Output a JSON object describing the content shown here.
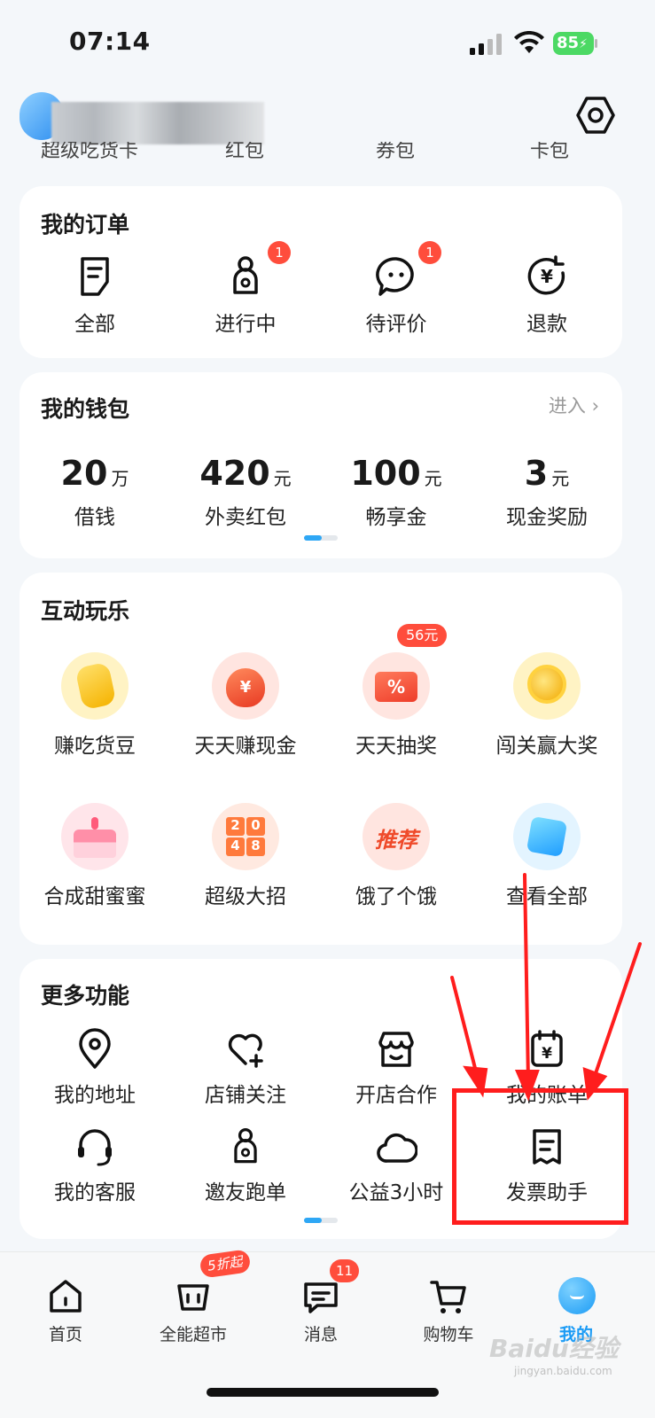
{
  "status_bar": {
    "time": "07:14",
    "battery": "85"
  },
  "header": {
    "peek_labels": [
      "超级吃货卡",
      "红包",
      "券包",
      "卡包"
    ]
  },
  "orders": {
    "title": "我的订单",
    "items": [
      {
        "label": "全部",
        "icon": "document-icon",
        "badge": ""
      },
      {
        "label": "进行中",
        "icon": "courier-icon",
        "badge": "1"
      },
      {
        "label": "待评价",
        "icon": "chat-bubble-icon",
        "badge": "1"
      },
      {
        "label": "退款",
        "icon": "refund-icon",
        "badge": ""
      }
    ]
  },
  "wallet": {
    "title": "我的钱包",
    "enter": "进入 ›",
    "items": [
      {
        "value": "20",
        "unit": "万",
        "label": "借钱"
      },
      {
        "value": "420",
        "unit": "元",
        "label": "外卖红包"
      },
      {
        "value": "100",
        "unit": "元",
        "label": "畅享金"
      },
      {
        "value": "3",
        "unit": "元",
        "label": "现金奖励"
      }
    ]
  },
  "games": {
    "title": "互动玩乐",
    "items": [
      {
        "label": "赚吃货豆",
        "icon": "bean-icon"
      },
      {
        "label": "天天赚现金",
        "icon": "money-bag-icon"
      },
      {
        "label": "天天抽奖",
        "icon": "lottery-ticket-icon",
        "badge": "56元"
      },
      {
        "label": "闯关赢大奖",
        "icon": "gold-coin-icon"
      },
      {
        "label": "合成甜蜜蜜",
        "icon": "cake-icon"
      },
      {
        "label": "超级大招",
        "icon": "game-2048-icon",
        "tile_text": [
          "2",
          "0",
          "4",
          "8"
        ]
      },
      {
        "label": "饿了个饿",
        "icon": "recommend-icon",
        "tile_text": "推荐"
      },
      {
        "label": "查看全部",
        "icon": "cube-icon"
      }
    ]
  },
  "more": {
    "title": "更多功能",
    "items": [
      {
        "label": "我的地址",
        "icon": "location-icon"
      },
      {
        "label": "店铺关注",
        "icon": "heart-plus-icon"
      },
      {
        "label": "开店合作",
        "icon": "shop-icon"
      },
      {
        "label": "我的账单",
        "icon": "bill-icon"
      },
      {
        "label": "我的客服",
        "icon": "headset-icon"
      },
      {
        "label": "邀友跑单",
        "icon": "courier-icon"
      },
      {
        "label": "公益3小时",
        "icon": "cloud-icon"
      },
      {
        "label": "发票助手",
        "icon": "invoice-icon"
      }
    ]
  },
  "tabbar": {
    "items": [
      {
        "label": "首页",
        "icon": "home-icon",
        "badge": ""
      },
      {
        "label": "全能超市",
        "icon": "supermarket-icon",
        "badge": "5折起"
      },
      {
        "label": "消息",
        "icon": "message-icon",
        "badge": "11"
      },
      {
        "label": "购物车",
        "icon": "cart-icon",
        "badge": ""
      },
      {
        "label": "我的",
        "icon": "profile-icon",
        "badge": ""
      }
    ]
  },
  "colors": {
    "accent": "#2ea7f5",
    "badge": "#ff4d3c",
    "annotation": "#ff1d1d"
  },
  "watermark": {
    "main": "Baidu经验",
    "sub": "jingyan.baidu.com"
  }
}
